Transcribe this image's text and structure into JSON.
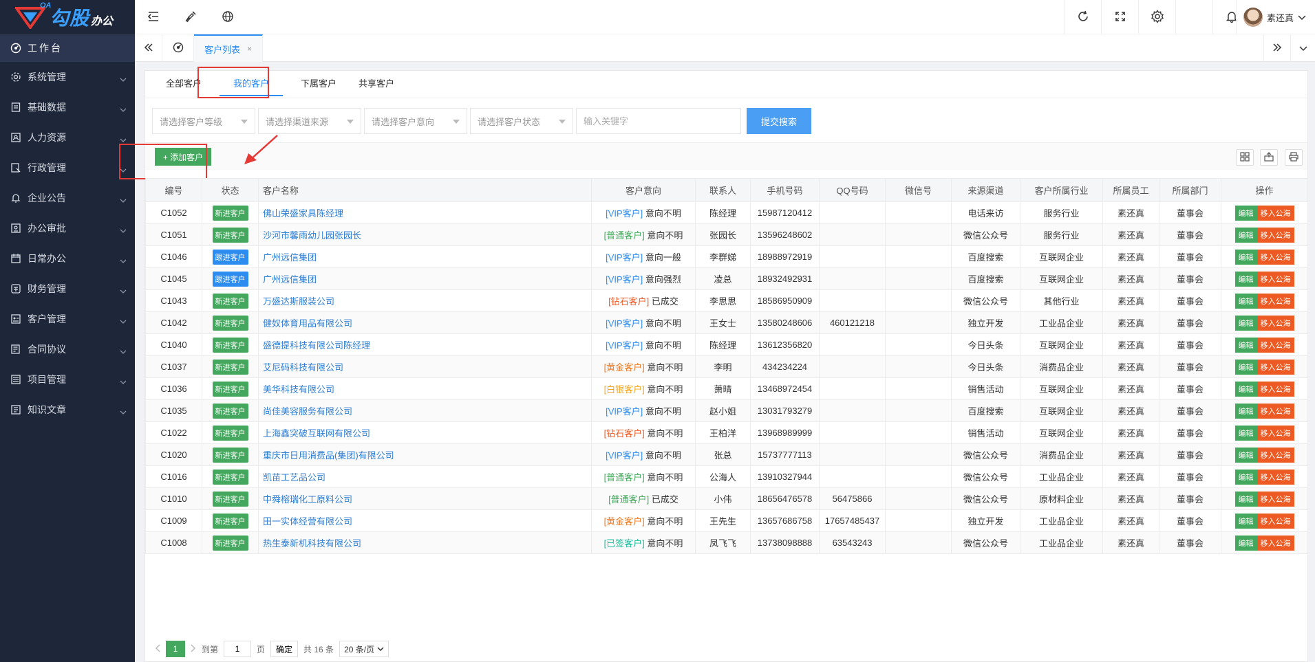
{
  "brand": {
    "oa": "OA",
    "name_big": "勾股",
    "name_small": "办公"
  },
  "sidebar": {
    "home": {
      "label": "工作台",
      "icon": "dashboard-icon"
    },
    "items": [
      {
        "label": "系统管理",
        "icon": "gear-icon"
      },
      {
        "label": "基础数据",
        "icon": "database-icon"
      },
      {
        "label": "人力资源",
        "icon": "person-icon"
      },
      {
        "label": "行政管理",
        "icon": "admin-icon"
      },
      {
        "label": "企业公告",
        "icon": "bell-icon"
      },
      {
        "label": "办公审批",
        "icon": "approval-icon"
      },
      {
        "label": "日常办公",
        "icon": "calendar-icon"
      },
      {
        "label": "财务管理",
        "icon": "finance-icon"
      },
      {
        "label": "客户管理",
        "icon": "customer-icon"
      },
      {
        "label": "合同协议",
        "icon": "contract-icon"
      },
      {
        "label": "项目管理",
        "icon": "project-icon"
      },
      {
        "label": "知识文章",
        "icon": "article-icon"
      }
    ]
  },
  "header": {
    "user_name": "素还真"
  },
  "tabbar": {
    "active_tab": "客户列表",
    "close": "×"
  },
  "subtabs": [
    "全部客户",
    "我的客户",
    "下属客户",
    "共享客户"
  ],
  "filters": {
    "level_placeholder": "请选择客户等级",
    "channel_placeholder": "请选择渠道来源",
    "intent_placeholder": "请选择客户意向",
    "status_placeholder": "请选择客户状态",
    "keyword_placeholder": "输入关键字",
    "submit": "提交搜索"
  },
  "toolbar": {
    "add_label": "+ 添加客户"
  },
  "table": {
    "headers": [
      "编号",
      "状态",
      "客户名称",
      "客户意向",
      "联系人",
      "手机号码",
      "QQ号码",
      "微信号",
      "来源渠道",
      "客户所属行业",
      "所属员工",
      "所属部门",
      "操作"
    ],
    "edit_label": "编辑",
    "pool_label": "移入公海",
    "rows": [
      {
        "id": "C1052",
        "status": "新进客户",
        "name": "佛山荣盛家具陈经理",
        "grade": "[VIP客户]",
        "intent": "意向不明",
        "contact": "陈经理",
        "phone": "15987120412",
        "qq": "",
        "wechat": "",
        "channel": "电话来访",
        "industry": "服务行业",
        "staff": "素还真",
        "dept": "董事会"
      },
      {
        "id": "C1051",
        "status": "新进客户",
        "name": "沙河市馨雨幼儿园张园长",
        "grade": "[普通客户]",
        "intent": "意向不明",
        "contact": "张园长",
        "phone": "13596248602",
        "qq": "",
        "wechat": "",
        "channel": "微信公众号",
        "industry": "服务行业",
        "staff": "素还真",
        "dept": "董事会"
      },
      {
        "id": "C1046",
        "status": "跟进客户",
        "name": "广州远信集团",
        "grade": "[VIP客户]",
        "intent": "意向一般",
        "contact": "李群娣",
        "phone": "18988972919",
        "qq": "",
        "wechat": "",
        "channel": "百度搜索",
        "industry": "互联网企业",
        "staff": "素还真",
        "dept": "董事会"
      },
      {
        "id": "C1045",
        "status": "跟进客户",
        "name": "广州远信集团",
        "grade": "[VIP客户]",
        "intent": "意向强烈",
        "contact": "凌总",
        "phone": "18932492931",
        "qq": "",
        "wechat": "",
        "channel": "百度搜索",
        "industry": "互联网企业",
        "staff": "素还真",
        "dept": "董事会"
      },
      {
        "id": "C1043",
        "status": "新进客户",
        "name": "万盛达斯服装公司",
        "grade": "[钻石客户]",
        "intent": "已成交",
        "contact": "李思思",
        "phone": "18586950909",
        "qq": "",
        "wechat": "",
        "channel": "微信公众号",
        "industry": "其他行业",
        "staff": "素还真",
        "dept": "董事会"
      },
      {
        "id": "C1042",
        "status": "新进客户",
        "name": "健奴体育用品有限公司",
        "grade": "[VIP客户]",
        "intent": "意向不明",
        "contact": "王女士",
        "phone": "13580248606",
        "qq": "460121218",
        "wechat": "",
        "channel": "独立开发",
        "industry": "工业品企业",
        "staff": "素还真",
        "dept": "董事会"
      },
      {
        "id": "C1040",
        "status": "新进客户",
        "name": "盛德提科技有限公司陈经理",
        "grade": "[VIP客户]",
        "intent": "意向不明",
        "contact": "陈经理",
        "phone": "13612356820",
        "qq": "",
        "wechat": "",
        "channel": "今日头条",
        "industry": "互联网企业",
        "staff": "素还真",
        "dept": "董事会"
      },
      {
        "id": "C1037",
        "status": "新进客户",
        "name": "艾尼码科技有限公司",
        "grade": "[黄金客户]",
        "intent": "意向不明",
        "contact": "李明",
        "phone": "434234224",
        "qq": "",
        "wechat": "",
        "channel": "今日头条",
        "industry": "消费品企业",
        "staff": "素还真",
        "dept": "董事会"
      },
      {
        "id": "C1036",
        "status": "新进客户",
        "name": "美华科技有限公司",
        "grade": "[白银客户]",
        "intent": "意向不明",
        "contact": "萧晴",
        "phone": "13468972454",
        "qq": "",
        "wechat": "",
        "channel": "销售活动",
        "industry": "互联网企业",
        "staff": "素还真",
        "dept": "董事会"
      },
      {
        "id": "C1035",
        "status": "新进客户",
        "name": "尚佳美容服务有限公司",
        "grade": "[VIP客户]",
        "intent": "意向不明",
        "contact": "赵小姐",
        "phone": "13031793279",
        "qq": "",
        "wechat": "",
        "channel": "百度搜索",
        "industry": "互联网企业",
        "staff": "素还真",
        "dept": "董事会"
      },
      {
        "id": "C1022",
        "status": "新进客户",
        "name": "上海鑫突破互联网有限公司",
        "grade": "[钻石客户]",
        "intent": "意向不明",
        "contact": "王柏洋",
        "phone": "13968989999",
        "qq": "",
        "wechat": "",
        "channel": "销售活动",
        "industry": "互联网企业",
        "staff": "素还真",
        "dept": "董事会"
      },
      {
        "id": "C1020",
        "status": "新进客户",
        "name": "重庆市日用消费品(集团)有限公司",
        "grade": "[VIP客户]",
        "intent": "意向不明",
        "contact": "张总",
        "phone": "15737777113",
        "qq": "",
        "wechat": "",
        "channel": "微信公众号",
        "industry": "消费品企业",
        "staff": "素还真",
        "dept": "董事会"
      },
      {
        "id": "C1016",
        "status": "新进客户",
        "name": "凯苗工艺品公司",
        "grade": "[普通客户]",
        "intent": "意向不明",
        "contact": "公海人",
        "phone": "13910327944",
        "qq": "",
        "wechat": "",
        "channel": "微信公众号",
        "industry": "工业品企业",
        "staff": "素还真",
        "dept": "董事会"
      },
      {
        "id": "C1010",
        "status": "新进客户",
        "name": "中舜榕瑞化工原料公司",
        "grade": "[普通客户]",
        "intent": "已成交",
        "contact": "小伟",
        "phone": "18656476578",
        "qq": "56475866",
        "wechat": "",
        "channel": "微信公众号",
        "industry": "原材料企业",
        "staff": "素还真",
        "dept": "董事会"
      },
      {
        "id": "C1009",
        "status": "新进客户",
        "name": "田一实体经营有限公司",
        "grade": "[黄金客户]",
        "intent": "意向不明",
        "contact": "王先生",
        "phone": "13657686758",
        "qq": "17657485437",
        "wechat": "",
        "channel": "独立开发",
        "industry": "工业品企业",
        "staff": "素还真",
        "dept": "董事会"
      },
      {
        "id": "C1008",
        "status": "新进客户",
        "name": "热生泰新机科技有限公司",
        "grade": "[已签客户]",
        "intent": "意向不明",
        "contact": "凤飞飞",
        "phone": "13738098888",
        "qq": "63543243",
        "wechat": "",
        "channel": "微信公众号",
        "industry": "工业品企业",
        "staff": "素还真",
        "dept": "董事会"
      }
    ]
  },
  "pager": {
    "current": "1",
    "goto_label": "到第",
    "page_label": "页",
    "confirm": "确定",
    "total": "共 16 条",
    "page_size": "20 条/页"
  },
  "colors": {
    "status_new": "#43a85d",
    "status_follow": "#2d8cf0",
    "grade_vip": "#2d8cf0",
    "grade_normal": "#43a85d",
    "grade_diamond": "#ee5a24",
    "grade_gold": "#ee7a24",
    "grade_silver": "#f5a623",
    "grade_signed": "#1abc9c",
    "highlight": "#e53935"
  }
}
